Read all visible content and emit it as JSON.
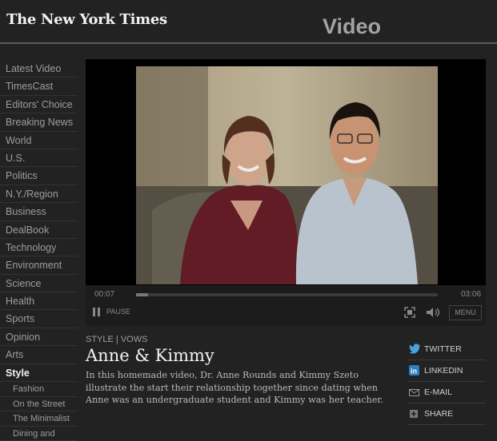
{
  "masthead": {
    "logo": "The New York Times",
    "section": "Video"
  },
  "nav": {
    "items": [
      {
        "label": "Latest Video",
        "active": false
      },
      {
        "label": "TimesCast",
        "active": false
      },
      {
        "label": "Editors' Choice",
        "active": false
      },
      {
        "label": "Breaking News",
        "active": false
      },
      {
        "label": "World",
        "active": false
      },
      {
        "label": "U.S.",
        "active": false
      },
      {
        "label": "Politics",
        "active": false
      },
      {
        "label": "N.Y./Region",
        "active": false
      },
      {
        "label": "Business",
        "active": false
      },
      {
        "label": "DealBook",
        "active": false
      },
      {
        "label": "Technology",
        "active": false
      },
      {
        "label": "Environment",
        "active": false
      },
      {
        "label": "Science",
        "active": false
      },
      {
        "label": "Health",
        "active": false
      },
      {
        "label": "Sports",
        "active": false
      },
      {
        "label": "Opinion",
        "active": false
      },
      {
        "label": "Arts",
        "active": false
      },
      {
        "label": "Style",
        "active": true
      }
    ],
    "subitems": [
      "Fashion",
      "On the Street",
      "The Minimalist",
      "Dining and"
    ]
  },
  "player": {
    "current_time": "00:07",
    "duration": "03:06",
    "progress_fraction": 0.04,
    "pause_label": "PAUSE",
    "menu_label": "MENU"
  },
  "article": {
    "kicker": "STYLE | VOWS",
    "headline": "Anne & Kimmy",
    "summary": "In this homemade video, Dr. Anne Rounds and Kimmy Szeto illustrate the start their relationship together since dating when Anne was an undergraduate student and Kimmy was her teacher."
  },
  "share": {
    "twitter": "TWITTER",
    "linkedin": "LINKEDIN",
    "email": "E-MAIL",
    "share": "SHARE"
  },
  "colors": {
    "background": "#222222",
    "accent_twitter": "#4aa3df",
    "accent_linkedin": "#2d7fc1"
  }
}
